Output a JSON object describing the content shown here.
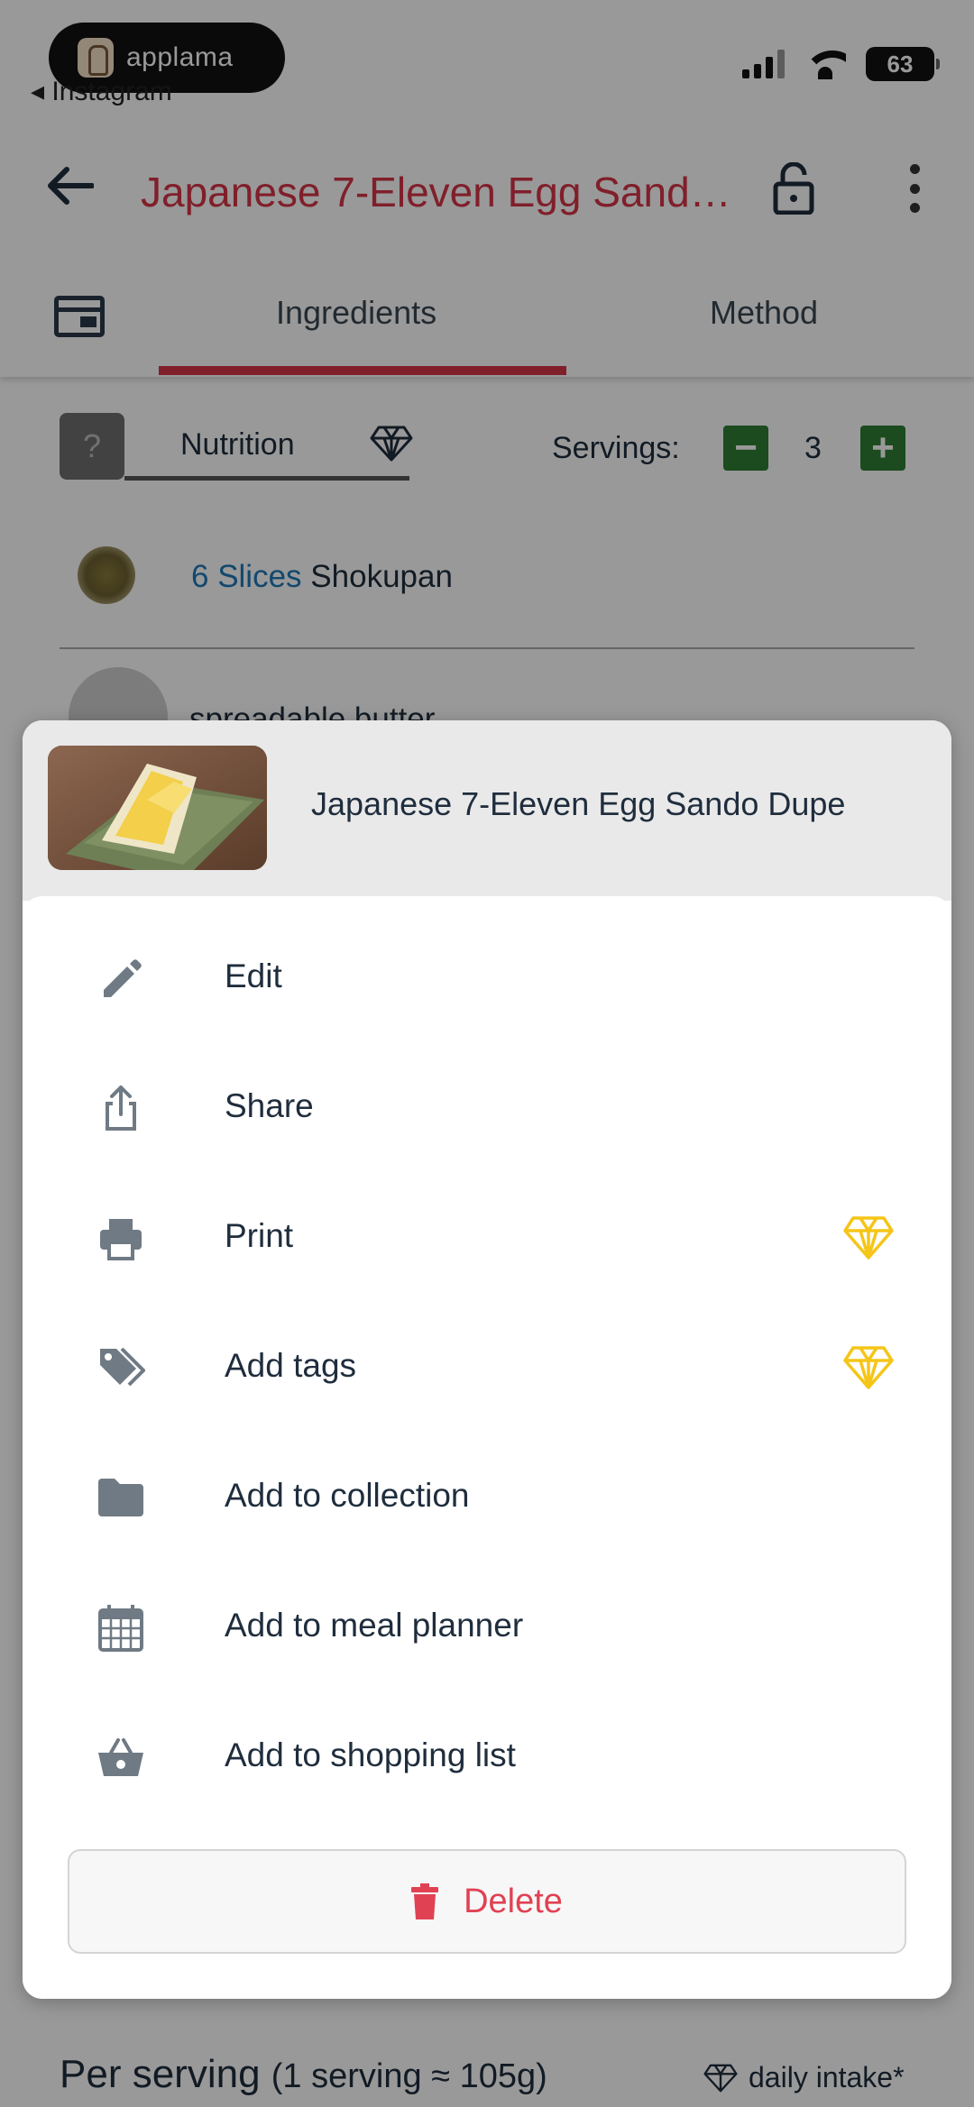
{
  "status_bar": {
    "overlay_app": "applama",
    "back_app": "◂ Instagram",
    "battery": "63"
  },
  "header": {
    "title": "Japanese 7-Eleven Egg Sand…"
  },
  "tabs": [
    {
      "label": "Ingredients",
      "active": true
    },
    {
      "label": "Method",
      "active": false
    }
  ],
  "nutrition_bar": {
    "help": "?",
    "nutrition_label": "Nutrition",
    "servings_label": "Servings:",
    "servings_value": "3",
    "minus": "−",
    "plus": "+"
  },
  "ingredients": [
    {
      "qty": "6 Slices",
      "name": "Shokupan"
    },
    {
      "qty": "",
      "name": "spreadable butter"
    }
  ],
  "per_serving": {
    "label": "Per serving",
    "detail": "(1 serving ≈ 105g)",
    "daily_intake": "daily intake*"
  },
  "sheet": {
    "title": "Japanese 7-Eleven Egg Sando Dupe",
    "items": [
      {
        "label": "Edit",
        "icon": "pencil-icon",
        "premium": false
      },
      {
        "label": "Share",
        "icon": "share-icon",
        "premium": false
      },
      {
        "label": "Print",
        "icon": "printer-icon",
        "premium": true
      },
      {
        "label": "Add tags",
        "icon": "tags-icon",
        "premium": true
      },
      {
        "label": "Add to collection",
        "icon": "folder-icon",
        "premium": false
      },
      {
        "label": "Add to meal planner",
        "icon": "calendar-icon",
        "premium": false
      },
      {
        "label": "Add to shopping list",
        "icon": "basket-icon",
        "premium": false
      }
    ],
    "delete_label": "Delete"
  },
  "colors": {
    "accent_red": "#d63447",
    "delete_red": "#e04253",
    "premium_gold": "#f5c518",
    "stepper_green": "#2e7d32",
    "icon_gray": "#6f7a84",
    "text_dark": "#1f2d3d"
  }
}
